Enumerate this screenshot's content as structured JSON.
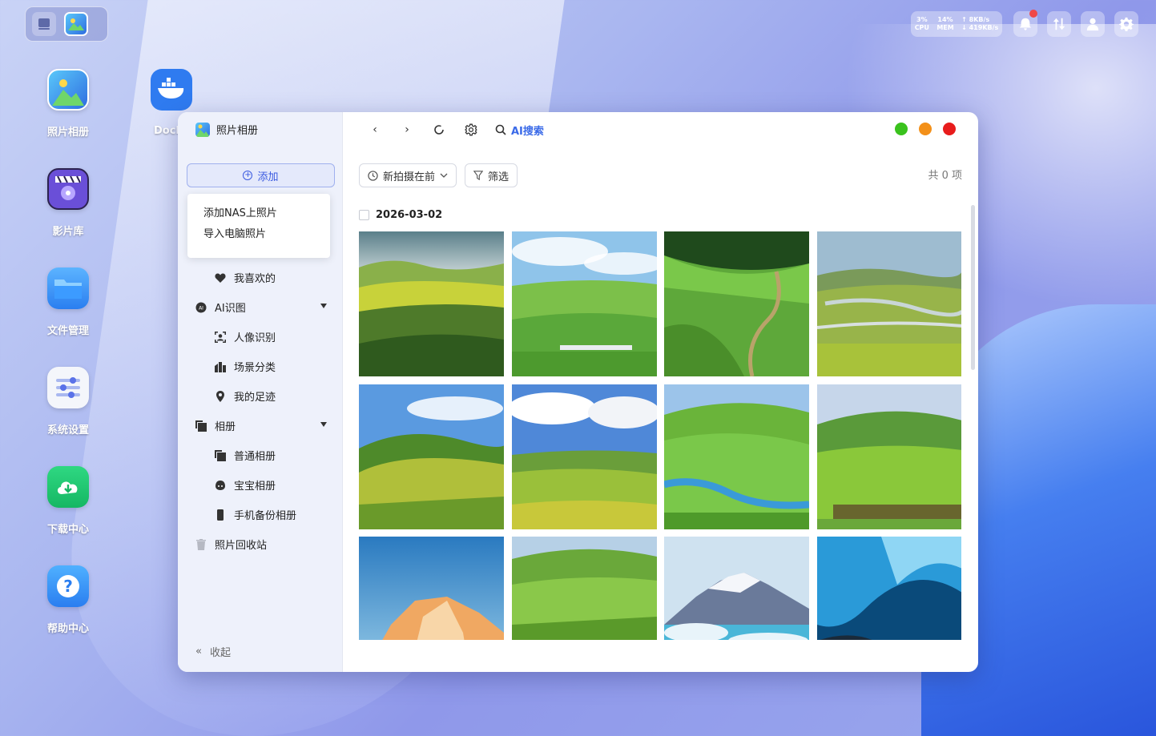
{
  "desktop": {
    "icons": [
      {
        "label": "照片相册"
      },
      {
        "label": "影片库"
      },
      {
        "label": "文件管理"
      },
      {
        "label": "系统设置"
      },
      {
        "label": "下载中心"
      },
      {
        "label": "帮助中心"
      }
    ],
    "docker_label": "Dock"
  },
  "status_bar": {
    "cpu_value": "3%",
    "cpu_label": "CPU",
    "mem_value": "14%",
    "mem_label": "MEM",
    "upload": "↑ 8KB/s",
    "download": "↓ 419KB/s"
  },
  "window": {
    "app_title": "照片相册",
    "add_button": "添加",
    "add_menu": [
      "添加NAS上照片",
      "导入电脑照片"
    ],
    "nav": {
      "favorites": "我喜欢的",
      "ai": "AI识图",
      "face": "人像识别",
      "scene": "场景分类",
      "footprint": "我的足迹",
      "album": "相册",
      "normal_album": "普通相册",
      "baby_album": "宝宝相册",
      "phone_backup": "手机备份相册",
      "recycle": "照片回收站"
    },
    "collapse": "收起",
    "toolbar": {
      "ai_search": "AI搜索"
    },
    "window_controls": {
      "colors": [
        "#3ac21d",
        "#f39019",
        "#e81c1c"
      ]
    },
    "sort": "新拍摄在前",
    "filter": "筛选",
    "count": "共 0 项",
    "date_group": "2026-03-02",
    "photos": [
      "grassland-cloudy",
      "grassland-tents",
      "forest-path-valley",
      "river-valley",
      "hills-horses",
      "wide-cloud-plain",
      "stream-green-hill",
      "horse-herd-field",
      "snow-peak-sunset",
      "green-meadow",
      "glacier-lake",
      "ice-cave"
    ]
  }
}
